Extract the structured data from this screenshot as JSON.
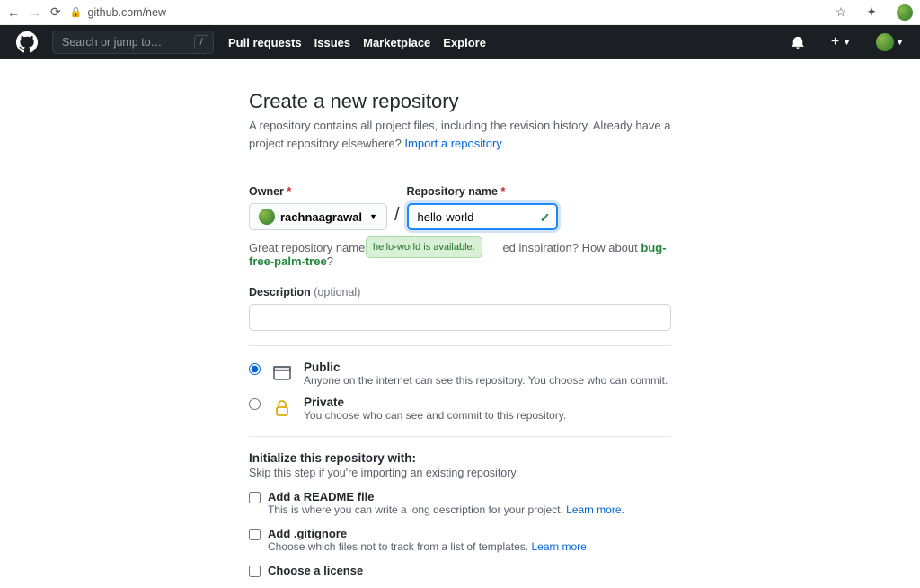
{
  "browser": {
    "url": "github.com/new"
  },
  "header": {
    "search_placeholder": "Search or jump to…",
    "slash": "/",
    "nav": {
      "pulls": "Pull requests",
      "issues": "Issues",
      "marketplace": "Marketplace",
      "explore": "Explore"
    }
  },
  "page": {
    "title": "Create a new repository",
    "subhead_prefix": "A repository contains all project files, including the revision history. Already have a project repository elsewhere? ",
    "import_link": "Import a repository.",
    "owner_label": "Owner",
    "owner_name": "rachnaagrawal",
    "repo_label": "Repository name",
    "repo_value": "hello-world",
    "hint_prefix": "Great repository names are sho",
    "hint_suffix": "ed inspiration? How about ",
    "hint_suggestion": "bug-free-palm-tree",
    "hint_q": "?",
    "available_msg": "hello-world is available.",
    "desc_label": "Description",
    "optional": "(optional)",
    "visibility": {
      "public": {
        "title": "Public",
        "sub": "Anyone on the internet can see this repository. You choose who can commit."
      },
      "private": {
        "title": "Private",
        "sub": "You choose who can see and commit to this repository."
      }
    },
    "init": {
      "heading": "Initialize this repository with:",
      "sub": "Skip this step if you're importing an existing repository.",
      "readme": {
        "title": "Add a README file",
        "sub_prefix": "This is where you can write a long description for your project. ",
        "learn": "Learn more."
      },
      "gitignore": {
        "title": "Add .gitignore",
        "sub_prefix": "Choose which files not to track from a list of templates. ",
        "learn": "Learn more."
      },
      "license": {
        "title": "Choose a license"
      }
    }
  }
}
